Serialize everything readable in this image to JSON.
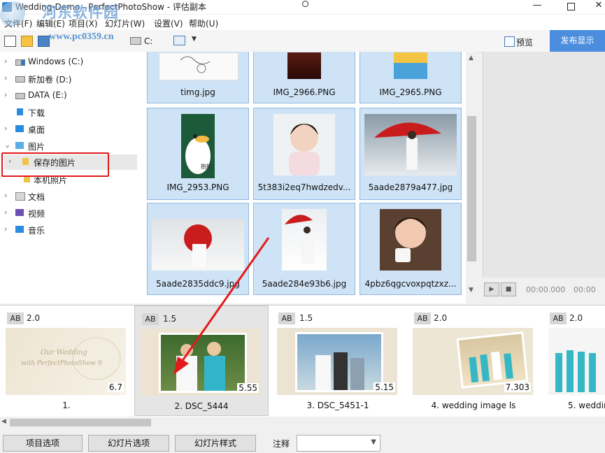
{
  "window": {
    "title": "Wedding-Demo - PerfectPhotoShow - 评估副本",
    "controls": {
      "minimize": "—",
      "close": "✕"
    }
  },
  "watermark": {
    "title": "河东软件园",
    "url": "www.pc0359.cn"
  },
  "menu": [
    "文件(F)",
    "编辑(E)",
    "项目(X)",
    "幻灯片(W)",
    "设置(V)",
    "帮助(U)"
  ],
  "toolbar": {
    "drive_label": "C:",
    "preview_label": "预览",
    "publish_label": "发布显示"
  },
  "tree": [
    {
      "label": "Windows (C:)",
      "icon": "windows-drive-icon"
    },
    {
      "label": "新加卷 (D:)",
      "icon": "drive-icon"
    },
    {
      "label": "DATA (E:)",
      "icon": "drive-icon"
    },
    {
      "label": "下载",
      "icon": "download-folder-icon"
    },
    {
      "label": "桌面",
      "icon": "desktop-folder-icon"
    },
    {
      "label": "图片",
      "icon": "pictures-folder-icon"
    },
    {
      "label": "保存的图片",
      "icon": "folder-icon"
    },
    {
      "label": "本机照片",
      "icon": "folder-icon"
    },
    {
      "label": "文档",
      "icon": "documents-folder-icon"
    },
    {
      "label": "视频",
      "icon": "videos-folder-icon"
    },
    {
      "label": "音乐",
      "icon": "music-folder-icon"
    }
  ],
  "thumbnails": [
    {
      "name": "timg.jpg"
    },
    {
      "name": "IMG_2966.PNG"
    },
    {
      "name": "IMG_2965.PNG"
    },
    {
      "name": "IMG_2953.PNG"
    },
    {
      "name": "5t383i2eq7hwdzedv..."
    },
    {
      "name": "5aade2879a477.jpg"
    },
    {
      "name": "5aade2835ddc9.jpg"
    },
    {
      "name": "5aade284e93b6.jpg"
    },
    {
      "name": "4pbz6qgcvoxpqtzxz..."
    }
  ],
  "thumb_text": {
    "cartoon_caption": "抱抱~"
  },
  "player": {
    "time_current": "00:00.000",
    "time_total": "00:00"
  },
  "slides": [
    {
      "ab": "AB",
      "duration": "2.0",
      "length": "6.7",
      "name": "1.",
      "overlay_line1": "Our Wedding",
      "overlay_line2": "with PerfectPhotoShow 9"
    },
    {
      "ab": "AB",
      "duration": "1.5",
      "length": "5.55",
      "name": "2. DSC_5444"
    },
    {
      "ab": "AB",
      "duration": "1.5",
      "length": "5.15",
      "name": "3. DSC_5451-1"
    },
    {
      "ab": "AB",
      "duration": "2.0",
      "length": "7.303",
      "name": "4. wedding image ls"
    },
    {
      "ab": "AB",
      "duration": "2.0",
      "length": "",
      "name": "5. weddin"
    }
  ],
  "bottom": {
    "project_options": "项目选项",
    "slide_options": "幻灯片选项",
    "slide_style": "幻灯片样式",
    "note_label": "注释"
  },
  "colors": {
    "accent": "#4c8ede",
    "selection": "#cfe3f6",
    "annotation": "#e31a1a"
  }
}
